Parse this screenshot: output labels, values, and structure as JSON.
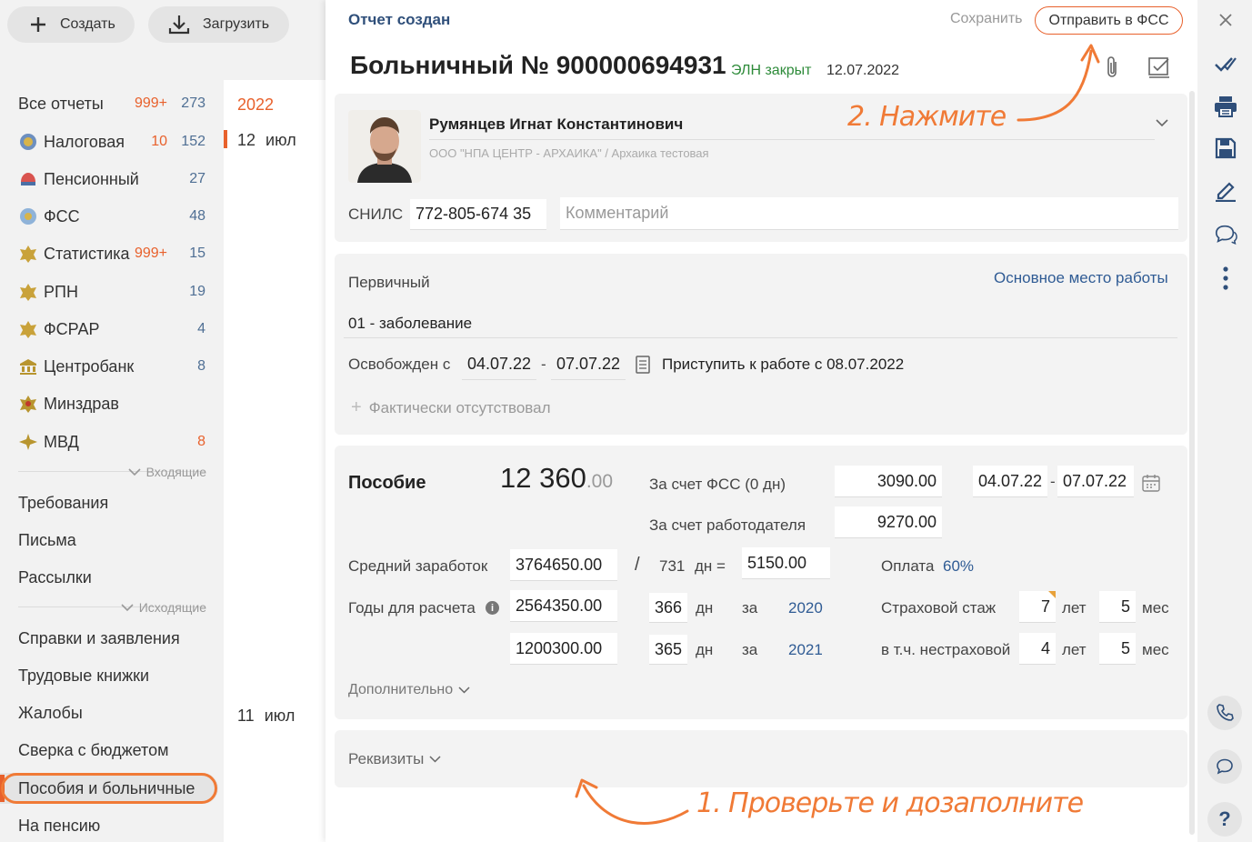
{
  "toolbar": {
    "create_label": "Создать",
    "upload_label": "Загрузить"
  },
  "sidebar": {
    "all_reports": {
      "label": "Все отчеты",
      "count_red": "999+",
      "count_blue": "273"
    },
    "items": [
      {
        "label": "Налоговая",
        "count_red": "10",
        "count_blue": "152",
        "icon": "tax-emblem-icon"
      },
      {
        "label": "Пенсионный",
        "count_red": "",
        "count_blue": "27",
        "icon": "pension-emblem-icon"
      },
      {
        "label": "ФСС",
        "count_red": "",
        "count_blue": "48",
        "icon": "fss-emblem-icon"
      },
      {
        "label": "Статистика",
        "count_red": "999+",
        "count_blue": "15",
        "icon": "stat-emblem-icon"
      },
      {
        "label": "РПН",
        "count_red": "",
        "count_blue": "19",
        "icon": "rpn-emblem-icon"
      },
      {
        "label": "ФСРАР",
        "count_red": "",
        "count_blue": "4",
        "icon": "fsrar-emblem-icon"
      },
      {
        "label": "Центробанк",
        "count_red": "",
        "count_blue": "8",
        "icon": "cb-emblem-icon"
      },
      {
        "label": "Минздрав",
        "count_red": "",
        "count_blue": "",
        "icon": "minzdrav-emblem-icon"
      },
      {
        "label": "МВД",
        "count_red": "8",
        "count_blue": "",
        "icon": "mvd-emblem-icon"
      }
    ],
    "incoming_label": "Входящие",
    "incoming": [
      "Требования",
      "Письма",
      "Рассылки"
    ],
    "outgoing_label": "Исходящие",
    "outgoing": [
      "Справки и заявления",
      "Трудовые книжки",
      "Жалобы",
      "Сверка с бюджетом",
      "Пособия и больничные",
      "На пенсию"
    ]
  },
  "timeline": {
    "year": "2022",
    "date1_day": "12",
    "date1_month": "июл",
    "date2_day": "11",
    "date2_month": "июл"
  },
  "header": {
    "status": "Отчет создан",
    "save_label": "Сохранить",
    "send_label": "Отправить в ФСС",
    "title": "Больничный № 900000694931",
    "eln_status": "ЭЛН закрыт",
    "date": "12.07.2022"
  },
  "employee": {
    "name": "Румянцев Игнат Константинович",
    "org": "ООО \"НПА ЦЕНТР - АРХАИКА\" / Архаика тестовая",
    "snils_label": "СНИЛС",
    "snils": "772-805-674 35",
    "comment_placeholder": "Комментарий"
  },
  "sick_leave": {
    "type": "Первичный",
    "workplace": "Основное место работы",
    "reason": "01 - заболевание",
    "released_label": "Освобожден с",
    "from": "04.07.22",
    "dash": "-",
    "to": "07.07.22",
    "return_text": "Приступить к работе с 08.07.2022",
    "absent_label": "Фактически отсутствовал"
  },
  "benefit": {
    "label": "Пособие",
    "amount_int": "12 360",
    "amount_dec": ".00",
    "fss_label": "За счет ФСС (0 дн)",
    "fss_value": "3090.00",
    "period_from": "04.07.22",
    "period_to": "07.07.22",
    "employer_label": "За счет работодателя",
    "employer_value": "9270.00",
    "avg_label": "Средний заработок",
    "avg_value": "3764650.00",
    "slash": "/",
    "days_total": "731",
    "days_eq": "дн =",
    "daily": "5150.00",
    "pay_label": "Оплата",
    "pay_value": "60%",
    "years_label": "Годы для расчета",
    "rows": [
      {
        "amount": "2564350.00",
        "days": "366",
        "days_unit": "дн",
        "for": "за",
        "year": "2020"
      },
      {
        "amount": "1200300.00",
        "days": "365",
        "days_unit": "дн",
        "for": "за",
        "year": "2021"
      }
    ],
    "insurance_label": "Страховой стаж",
    "insurance_years": "7",
    "insurance_months": "5",
    "noninsurance_label": "в т.ч. нестраховой",
    "noninsurance_years": "4",
    "noninsurance_months": "5",
    "years_unit": "лет",
    "months_unit": "мес",
    "more_label": "Дополнительно"
  },
  "requisites_label": "Реквизиты",
  "annotations": {
    "step1": "1. Проверьте и дозаполните",
    "step2": "2. Нажмите"
  },
  "colors": {
    "accent": "#e8612c",
    "blue": "#2f5b94",
    "green": "#2e8b3a",
    "annotation": "#f07a36"
  }
}
